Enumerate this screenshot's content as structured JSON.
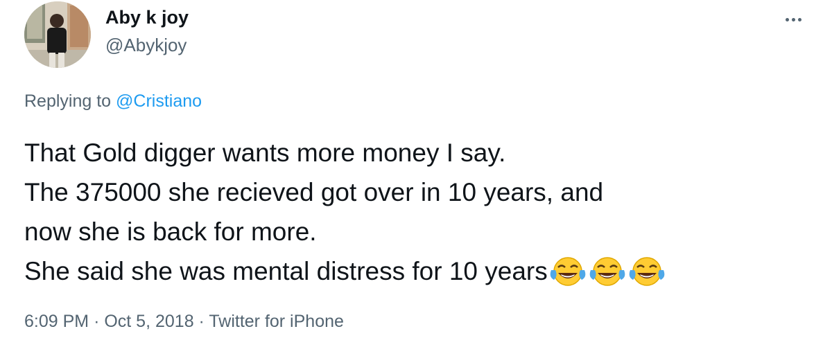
{
  "author": {
    "display_name": "Aby k joy",
    "handle": "@Abykjoy"
  },
  "reply_context": {
    "prefix": "Replying to",
    "mention": "@Cristiano"
  },
  "tweet_lines": [
    "That Gold digger wants more money I say.",
    "The 375000 she recieved got over in 10 years, and",
    "now she is back for more.",
    "She said she was mental distress for 10 years"
  ],
  "emojis": [
    "face-with-tears-of-joy",
    "face-with-tears-of-joy",
    "face-with-tears-of-joy"
  ],
  "meta": {
    "time": "6:09 PM",
    "separator": "·",
    "date": "Oct 5, 2018",
    "source": "Twitter for iPhone"
  },
  "colors": {
    "text": "#0f1419",
    "secondary": "#536471",
    "link": "#1d9bf0"
  },
  "icons": {
    "more": "more-horizontal-icon"
  }
}
